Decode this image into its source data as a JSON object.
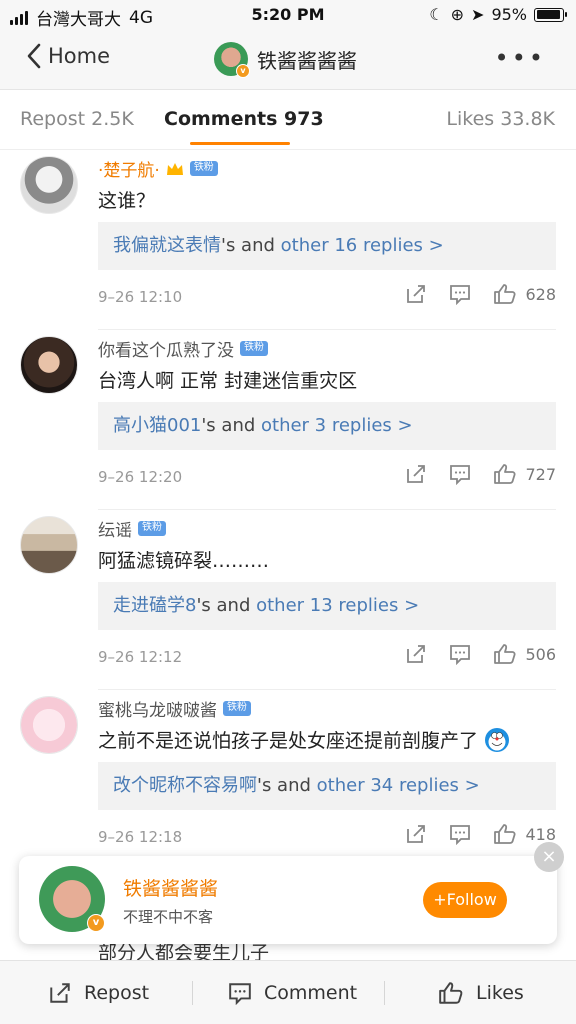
{
  "status": {
    "carrier": "台灣大哥大",
    "network": "4G",
    "time": "5:20 PM",
    "battery": "95%",
    "battery_level": 0.95
  },
  "nav": {
    "back_label": "Home",
    "title": "铁酱酱酱酱",
    "more_icon": "ellipsis-icon"
  },
  "tabs": [
    {
      "label": "Repost 2.5K"
    },
    {
      "label": "Comments 973"
    },
    {
      "label": "Likes 33.8K"
    }
  ],
  "colors": {
    "accent": "#ff8200",
    "link": "#4a7bb5",
    "name_orange": "#f07c00",
    "fan_badge": "#5c9ce6"
  },
  "fan_badge": "铁粉",
  "comments": [
    {
      "name": "·楚子航·",
      "text": "这谁？",
      "reply_user": "我偏就这表情",
      "reply_mid": "'s and ",
      "reply_link": "other 16 replies >",
      "time": "9–26 12:10",
      "likes": "628"
    },
    {
      "name": "你看这个瓜熟了没",
      "text": "台湾人啊 正常 封建迷信重灾区",
      "reply_user": "高小猫001",
      "reply_mid": "'s and ",
      "reply_link": "other 3 replies >",
      "time": "9–26 12:20",
      "likes": "727"
    },
    {
      "name": "纭谣",
      "text": "阿猛滤镜碎裂………",
      "reply_user": "走进磕学8",
      "reply_mid": "'s and ",
      "reply_link": "other 13 replies >",
      "time": "9–26 12:12",
      "likes": "506"
    },
    {
      "name": "蜜桃乌龙啵啵酱",
      "text": "之前不是还说怕孩子是处女座还提前剖腹产了",
      "reply_user": "改个昵称不容易啊",
      "reply_mid": "'s and ",
      "reply_link": "other 34 replies >",
      "time": "9–26 12:18",
      "likes": "418"
    }
  ],
  "follow_card": {
    "name": "铁酱酱酱酱",
    "subtitle": "不理不中不客",
    "button": "+Follow",
    "close": "×"
  },
  "ghost_line": "部分人都会要生儿子",
  "bottom_bar": {
    "repost": "Repost",
    "comment": "Comment",
    "likes": "Likes"
  }
}
